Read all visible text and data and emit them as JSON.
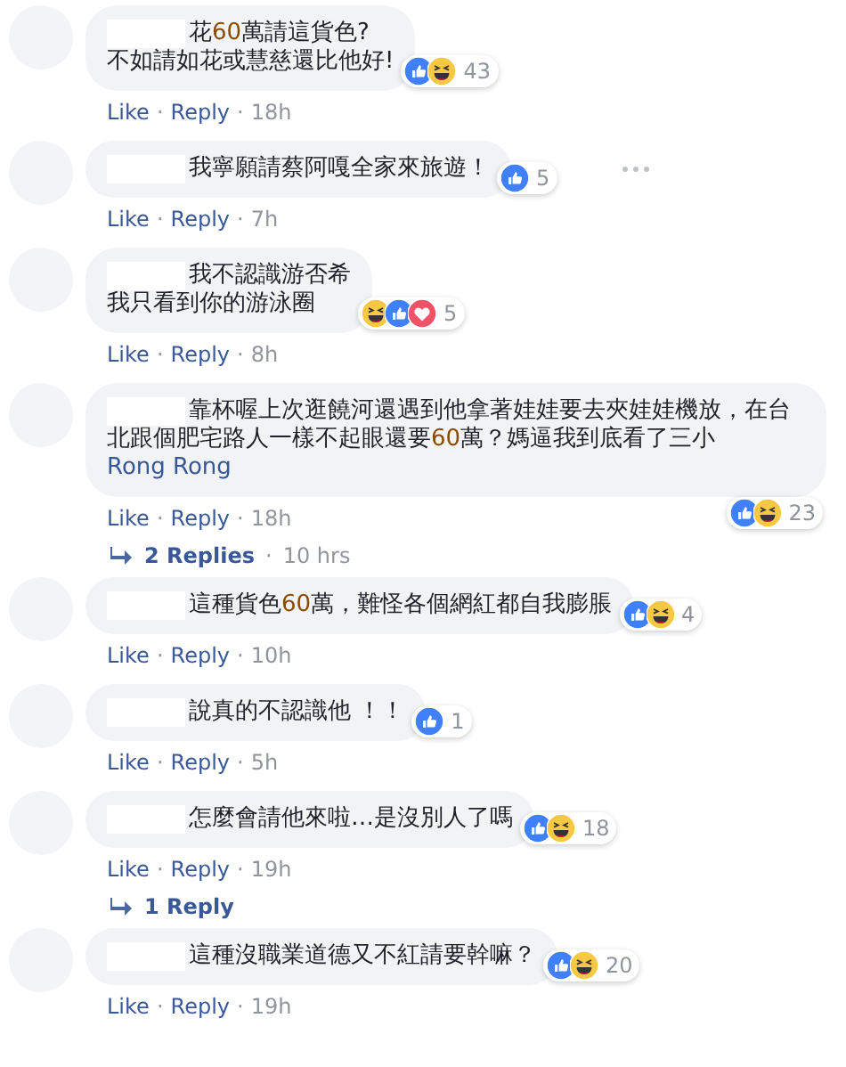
{
  "comments": [
    {
      "segments": [
        {
          "kind": "plain",
          "text": "花"
        },
        {
          "kind": "number",
          "text": "60"
        },
        {
          "kind": "plain",
          "text": "萬請這貨色?"
        },
        {
          "kind": "break"
        },
        {
          "kind": "plain",
          "text": "不如請如花或慧慈還比他好!"
        }
      ],
      "reactions": [
        {
          "kind": "like"
        },
        {
          "kind": "haha"
        }
      ],
      "count": "43",
      "actions": [
        "Like",
        "Reply"
      ],
      "separator": "·",
      "time": "18h",
      "menu_visible": false
    },
    {
      "segments": [
        {
          "kind": "plain",
          "text": "我寧願請蔡阿嘎全家來旅遊！"
        }
      ],
      "reactions": [
        {
          "kind": "like"
        }
      ],
      "count": "5",
      "actions": [
        "Like",
        "Reply"
      ],
      "separator": "·",
      "time": "7h",
      "menu_visible": true
    },
    {
      "segments": [
        {
          "kind": "plain",
          "text": "我不認識游否希"
        },
        {
          "kind": "break"
        },
        {
          "kind": "plain",
          "text": "我只看到你的游泳圈"
        }
      ],
      "reactions": [
        {
          "kind": "haha"
        },
        {
          "kind": "like"
        },
        {
          "kind": "love"
        }
      ],
      "count": "5",
      "actions": [
        "Like",
        "Reply"
      ],
      "separator": "·",
      "time": "8h",
      "menu_visible": false
    },
    {
      "segments": [
        {
          "kind": "plain",
          "text": "靠杯喔上次逛饒河還遇到他拿著娃娃要去夾娃娃機放，在台北跟個肥宅路人一樣不起眼還要"
        },
        {
          "kind": "number",
          "text": "60"
        },
        {
          "kind": "plain",
          "text": "萬？媽逼我到底看了三小 "
        },
        {
          "kind": "mention",
          "text": "Rong Rong"
        }
      ],
      "reactions": [
        {
          "kind": "like"
        },
        {
          "kind": "haha"
        }
      ],
      "count": "23",
      "actions": [
        "Like",
        "Reply"
      ],
      "separator": "·",
      "time": "18h",
      "menu_visible": false,
      "replies": {
        "label": "2 Replies",
        "separator": "·",
        "time": "10 hrs"
      }
    },
    {
      "segments": [
        {
          "kind": "plain",
          "text": "這種貨色"
        },
        {
          "kind": "number",
          "text": "60"
        },
        {
          "kind": "plain",
          "text": "萬，難怪各個網紅都自我膨脹"
        }
      ],
      "reactions": [
        {
          "kind": "like"
        },
        {
          "kind": "haha"
        }
      ],
      "count": "4",
      "actions": [
        "Like",
        "Reply"
      ],
      "separator": "·",
      "time": "10h",
      "menu_visible": false
    },
    {
      "segments": [
        {
          "kind": "plain",
          "text": "說真的不認識他 ！！"
        }
      ],
      "reactions": [
        {
          "kind": "like"
        }
      ],
      "count": "1",
      "actions": [
        "Like",
        "Reply"
      ],
      "separator": "·",
      "time": "5h",
      "menu_visible": false
    },
    {
      "segments": [
        {
          "kind": "plain",
          "text": "怎麼會請他來啦…是沒別人了嗎"
        }
      ],
      "reactions": [
        {
          "kind": "like"
        },
        {
          "kind": "haha"
        }
      ],
      "count": "18",
      "actions": [
        "Like",
        "Reply"
      ],
      "separator": "·",
      "time": "19h",
      "menu_visible": false,
      "replies": {
        "label": "1 Reply"
      }
    },
    {
      "segments": [
        {
          "kind": "plain",
          "text": "這種沒職業道德又不紅請要幹嘛？"
        }
      ],
      "reactions": [
        {
          "kind": "like"
        },
        {
          "kind": "haha"
        }
      ],
      "count": "20",
      "actions": [
        "Like",
        "Reply"
      ],
      "separator": "·",
      "time": "19h",
      "menu_visible": false
    }
  ]
}
